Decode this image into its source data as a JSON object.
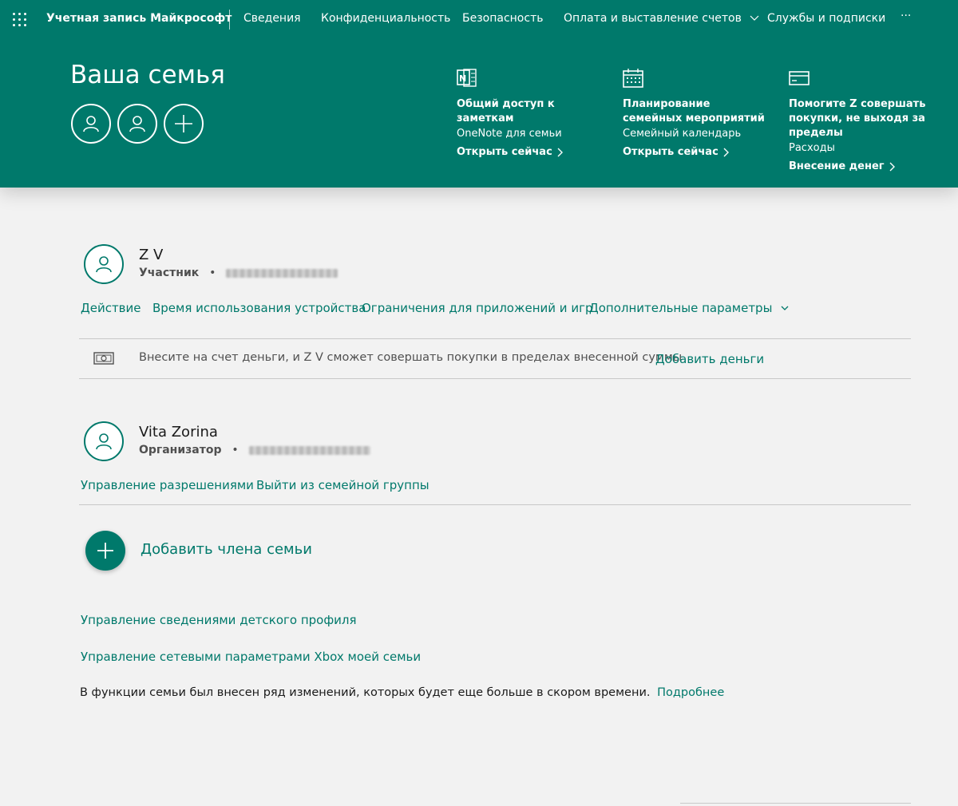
{
  "nav": {
    "brand": "Учетная запись Майкрософт",
    "items": [
      "Сведения",
      "Конфиденциальность",
      "Безопасность",
      "Оплата и выставление счетов",
      "Службы и подписки"
    ],
    "more": "···"
  },
  "hero": {
    "title": "Ваша семья",
    "features": [
      {
        "title_line1": "Общий доступ к",
        "title_line2": "заметкам",
        "subtitle": "OneNote для семьи",
        "link": "Открыть сейчас",
        "icon": "onenote-icon"
      },
      {
        "title_line1": "Планирование",
        "title_line2": "семейных мероприятий",
        "subtitle": "Семейный календарь",
        "link": "Открыть сейчас",
        "icon": "calendar-icon"
      },
      {
        "title_line1": "Помогите Z совершать",
        "title_line2": "покупки, не выходя за",
        "title_line3": "пределы",
        "subtitle": "Расходы",
        "link": "Внесение денег",
        "icon": "card-icon"
      }
    ]
  },
  "members": [
    {
      "name": "Z V",
      "role": "Участник",
      "links": [
        "Действие",
        "Время использования устройства",
        "Ограничения для приложений и игр",
        "Дополнительные параметры"
      ],
      "money_text": "Внесите на счет деньги, и Z V сможет совершать покупки в пределах внесенной суммы",
      "money_link": "Добавить деньги"
    },
    {
      "name": "Vita Zorina",
      "role": "Организатор",
      "links": [
        "Управление разрешениями",
        "Выйти из семейной группы"
      ]
    }
  ],
  "add_member": "Добавить члена семьи",
  "footer_links": [
    "Управление сведениями детского профиля",
    "Управление сетевыми параметрами Xbox моей семьи"
  ],
  "notice": {
    "text": "В функции семьи был внесен ряд изменений, которых будет еще больше в скором времени.",
    "link": "Подробнее"
  },
  "colors": {
    "accent": "#00796b",
    "background": "#f2f2f2"
  }
}
